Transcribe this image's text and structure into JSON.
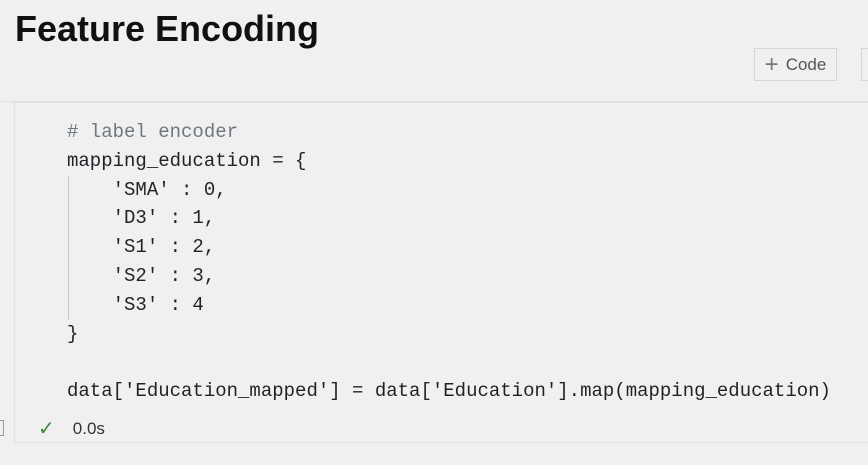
{
  "heading": "Feature Encoding",
  "toolbar": {
    "add_code_label": "Code",
    "add_code_icon": "plus-icon"
  },
  "cell": {
    "lines": [
      "# label encoder",
      "mapping_education = {",
      "    'SMA' : 0,",
      "    'D3' : 1,",
      "    'S1' : 2,",
      "    'S2' : 3,",
      "    'S3' : 4",
      "}",
      "",
      "data['Education_mapped'] = data['Education'].map(mapping_education)"
    ],
    "status_icon": "check-icon",
    "execution_time": "0.0s"
  },
  "colors": {
    "comment": "#6e7781",
    "string": "#032f62",
    "number": "#005cc5",
    "success": "#388a34"
  }
}
